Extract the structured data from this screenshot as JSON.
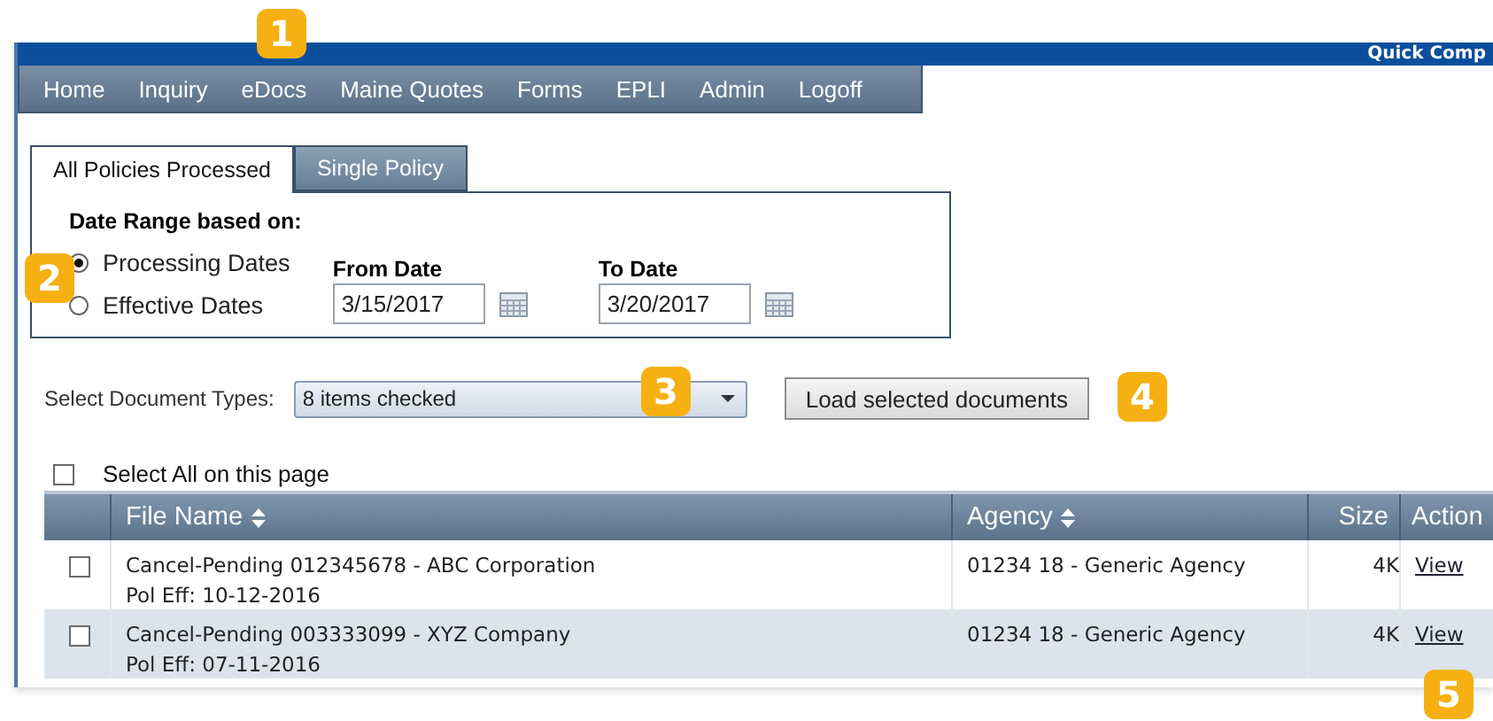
{
  "banner": {
    "title": "Quick Comp"
  },
  "nav": [
    {
      "label": "Home"
    },
    {
      "label": "Inquiry"
    },
    {
      "label": "eDocs"
    },
    {
      "label": "Maine Quotes"
    },
    {
      "label": "Forms"
    },
    {
      "label": "EPLI"
    },
    {
      "label": "Admin"
    },
    {
      "label": "Logoff"
    }
  ],
  "tabs": [
    {
      "label": "All Policies Processed",
      "selected": true
    },
    {
      "label": "Single Policy",
      "selected": false
    }
  ],
  "date_range": {
    "heading": "Date Range based on:",
    "options": [
      {
        "label": "Processing Dates",
        "selected": true
      },
      {
        "label": "Effective Dates",
        "selected": false
      }
    ],
    "from": {
      "label": "From Date",
      "value": "3/15/2017"
    },
    "to": {
      "label": "To Date",
      "value": "3/20/2017"
    }
  },
  "document_types": {
    "label": "Select Document Types:",
    "value": "8 items checked"
  },
  "load_button": "Load selected documents",
  "select_all": {
    "label": "Select All on this page",
    "checked": false
  },
  "table": {
    "columns": [
      {
        "label": "File Name",
        "sortable": true
      },
      {
        "label": "Agency",
        "sortable": true
      },
      {
        "label": "Size",
        "sortable": false
      },
      {
        "label": "Action",
        "sortable": false
      }
    ],
    "rows": [
      {
        "checked": false,
        "file": "Cancel-Pending 012345678 - ABC Corporation",
        "pol_eff": "Pol Eff: 10-12-2016",
        "agency": "01234 18 - Generic Agency",
        "size": "4K",
        "action": "View"
      },
      {
        "checked": false,
        "file": "Cancel-Pending 003333099 - XYZ Company",
        "pol_eff": "Pol Eff: 07-11-2016",
        "agency": "01234 18 - Generic Agency",
        "size": "4K",
        "action": "View"
      }
    ]
  },
  "callouts": [
    "1",
    "2",
    "3",
    "4",
    "5"
  ]
}
